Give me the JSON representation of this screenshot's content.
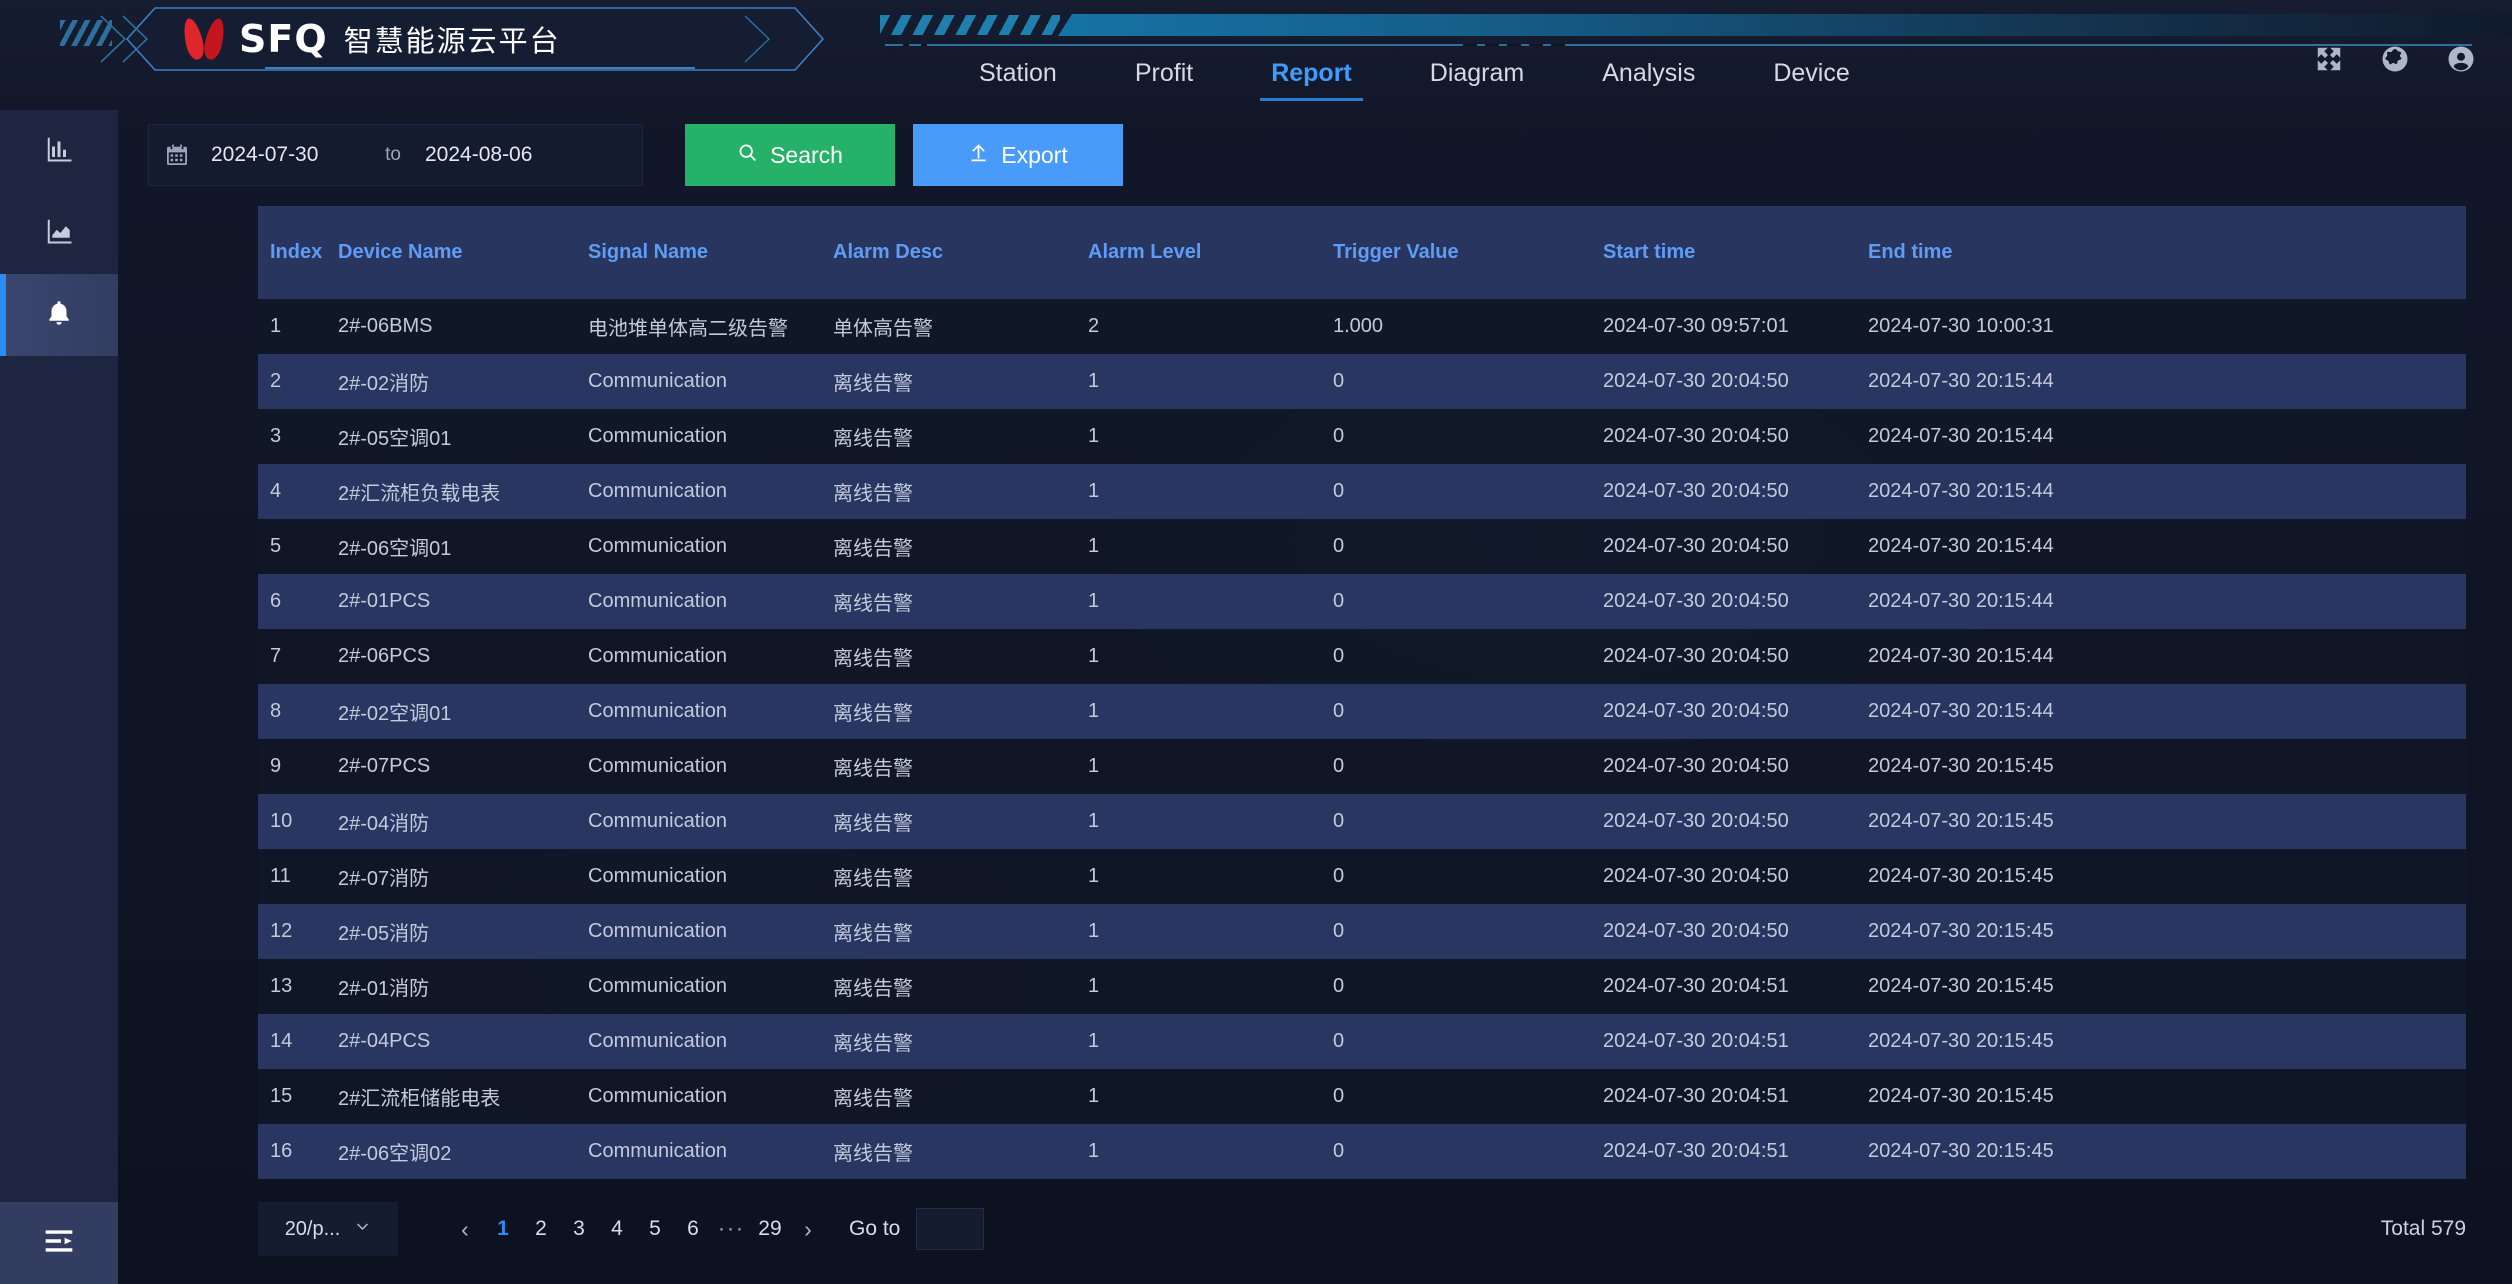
{
  "header": {
    "brand_abbr": "SFQ",
    "brand_name": "智慧能源云平台",
    "nav": [
      {
        "label": "Station",
        "active": false
      },
      {
        "label": "Profit",
        "active": false
      },
      {
        "label": "Report",
        "active": true
      },
      {
        "label": "Diagram",
        "active": false
      },
      {
        "label": "Analysis",
        "active": false
      },
      {
        "label": "Device",
        "active": false
      }
    ],
    "icons": [
      "fullscreen-icon",
      "globe-icon",
      "user-account-icon"
    ]
  },
  "sidebar": {
    "items": [
      {
        "icon": "bar-chart-icon",
        "active": false
      },
      {
        "icon": "area-chart-icon",
        "active": false
      },
      {
        "icon": "bell-alarm-icon",
        "active": true
      }
    ],
    "collapse_icon": "menu-collapse-icon"
  },
  "toolbar": {
    "calendar_icon": "calendar-icon",
    "start_date": "2024-07-30",
    "separator": "to",
    "end_date": "2024-08-06",
    "search_label": "Search",
    "search_icon": "search-icon",
    "export_label": "Export",
    "export_icon": "upload-icon",
    "search_color": "#25b268",
    "export_color": "#489bf8"
  },
  "table": {
    "columns": [
      "Index",
      "Device Name",
      "Signal Name",
      "Alarm Desc",
      "Alarm Level",
      "Trigger Value",
      "Start time",
      "End time"
    ],
    "rows": [
      [
        "1",
        "2#-06BMS",
        "电池堆单体高二级告警",
        "单体高告警",
        "2",
        "1.000",
        "2024-07-30 09:57:01",
        "2024-07-30 10:00:31"
      ],
      [
        "2",
        "2#-02消防",
        "Communication",
        "离线告警",
        "1",
        "0",
        "2024-07-30 20:04:50",
        "2024-07-30 20:15:44"
      ],
      [
        "3",
        "2#-05空调01",
        "Communication",
        "离线告警",
        "1",
        "0",
        "2024-07-30 20:04:50",
        "2024-07-30 20:15:44"
      ],
      [
        "4",
        "2#汇流柜负载电表",
        "Communication",
        "离线告警",
        "1",
        "0",
        "2024-07-30 20:04:50",
        "2024-07-30 20:15:44"
      ],
      [
        "5",
        "2#-06空调01",
        "Communication",
        "离线告警",
        "1",
        "0",
        "2024-07-30 20:04:50",
        "2024-07-30 20:15:44"
      ],
      [
        "6",
        "2#-01PCS",
        "Communication",
        "离线告警",
        "1",
        "0",
        "2024-07-30 20:04:50",
        "2024-07-30 20:15:44"
      ],
      [
        "7",
        "2#-06PCS",
        "Communication",
        "离线告警",
        "1",
        "0",
        "2024-07-30 20:04:50",
        "2024-07-30 20:15:44"
      ],
      [
        "8",
        "2#-02空调01",
        "Communication",
        "离线告警",
        "1",
        "0",
        "2024-07-30 20:04:50",
        "2024-07-30 20:15:44"
      ],
      [
        "9",
        "2#-07PCS",
        "Communication",
        "离线告警",
        "1",
        "0",
        "2024-07-30 20:04:50",
        "2024-07-30 20:15:45"
      ],
      [
        "10",
        "2#-04消防",
        "Communication",
        "离线告警",
        "1",
        "0",
        "2024-07-30 20:04:50",
        "2024-07-30 20:15:45"
      ],
      [
        "11",
        "2#-07消防",
        "Communication",
        "离线告警",
        "1",
        "0",
        "2024-07-30 20:04:50",
        "2024-07-30 20:15:45"
      ],
      [
        "12",
        "2#-05消防",
        "Communication",
        "离线告警",
        "1",
        "0",
        "2024-07-30 20:04:50",
        "2024-07-30 20:15:45"
      ],
      [
        "13",
        "2#-01消防",
        "Communication",
        "离线告警",
        "1",
        "0",
        "2024-07-30 20:04:51",
        "2024-07-30 20:15:45"
      ],
      [
        "14",
        "2#-04PCS",
        "Communication",
        "离线告警",
        "1",
        "0",
        "2024-07-30 20:04:51",
        "2024-07-30 20:15:45"
      ],
      [
        "15",
        "2#汇流柜储能电表",
        "Communication",
        "离线告警",
        "1",
        "0",
        "2024-07-30 20:04:51",
        "2024-07-30 20:15:45"
      ],
      [
        "16",
        "2#-06空调02",
        "Communication",
        "离线告警",
        "1",
        "0",
        "2024-07-30 20:04:51",
        "2024-07-30 20:15:45"
      ]
    ]
  },
  "pagination": {
    "page_size_label": "20/p...",
    "prev_icon": "chevron-left-icon",
    "next_icon": "chevron-right-icon",
    "pages": [
      "1",
      "2",
      "3",
      "4",
      "5",
      "6",
      "···",
      "29"
    ],
    "current_page": "1",
    "goto_label": "Go to",
    "goto_value": "",
    "total_label": "Total 579"
  }
}
